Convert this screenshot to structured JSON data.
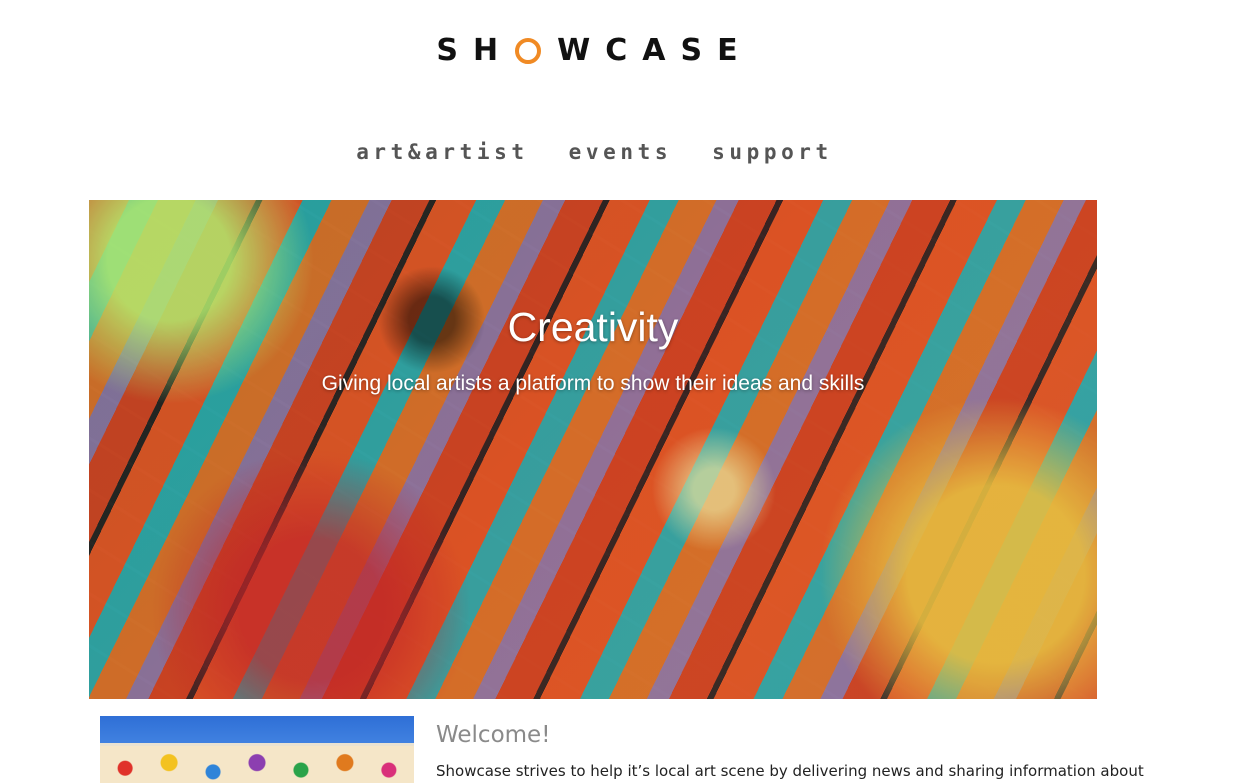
{
  "brand": {
    "name": "SHOWCASE",
    "letters_before": "SH",
    "letters_after": "WCASE",
    "accent_color": "#f08a24"
  },
  "nav": {
    "items": [
      {
        "label": "art&artist"
      },
      {
        "label": "events"
      },
      {
        "label": "support"
      }
    ]
  },
  "hero": {
    "title": "Creativity",
    "subtitle": "Giving local artists a platform to show their ideas and skills"
  },
  "welcome": {
    "heading": "Welcome!",
    "text": "Showcase strives to help it’s local art scene by delivering news and sharing information about"
  }
}
